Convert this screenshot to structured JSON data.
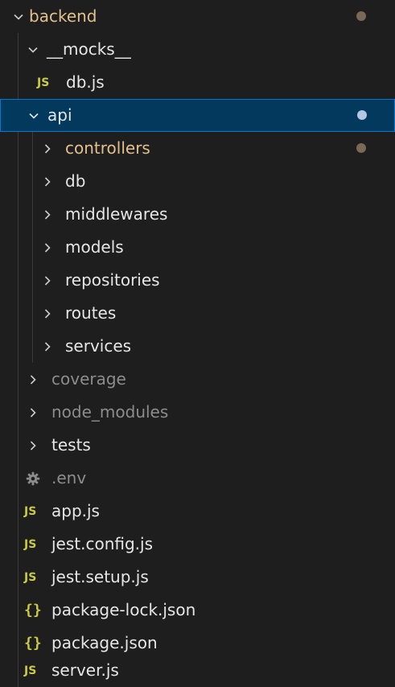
{
  "tree": {
    "backend": {
      "label": "backend",
      "icon": "chevron-down-icon",
      "badge": "modified-dot"
    },
    "mocks": {
      "label": "__mocks__",
      "icon": "chevron-down-icon"
    },
    "mocks_db": {
      "label": "db.js",
      "icon_text": "JS"
    },
    "api": {
      "label": "api",
      "icon": "chevron-down-icon",
      "badge": "modified-dot",
      "selected": true
    },
    "controllers": {
      "label": "controllers",
      "icon": "chevron-right-icon",
      "badge": "modified-dot"
    },
    "db": {
      "label": "db",
      "icon": "chevron-right-icon"
    },
    "middlewares": {
      "label": "middlewares",
      "icon": "chevron-right-icon"
    },
    "models": {
      "label": "models",
      "icon": "chevron-right-icon"
    },
    "repositories": {
      "label": "repositories",
      "icon": "chevron-right-icon"
    },
    "routes": {
      "label": "routes",
      "icon": "chevron-right-icon"
    },
    "services": {
      "label": "services",
      "icon": "chevron-right-icon"
    },
    "coverage": {
      "label": "coverage",
      "icon": "chevron-right-icon"
    },
    "node_modules": {
      "label": "node_modules",
      "icon": "chevron-right-icon"
    },
    "tests": {
      "label": "tests",
      "icon": "chevron-right-icon"
    },
    "env": {
      "label": ".env",
      "icon": "gear-icon"
    },
    "app": {
      "label": "app.js",
      "icon_text": "JS"
    },
    "jest_config": {
      "label": "jest.config.js",
      "icon_text": "JS"
    },
    "jest_setup": {
      "label": "jest.setup.js",
      "icon_text": "JS"
    },
    "package_lock": {
      "label": "package-lock.json",
      "icon_text": "{}"
    },
    "package": {
      "label": "package.json",
      "icon_text": "{}"
    },
    "server": {
      "label": "server.js",
      "icon_text": "JS"
    }
  },
  "colors": {
    "background": "#1e1e1e",
    "selected_background": "#04395e",
    "selected_border": "#0078d4",
    "modified_text": "#e2c08d",
    "ignored_text": "#8c8c8c",
    "js_icon": "#cbcb41",
    "json_icon": "#cbcb41"
  }
}
